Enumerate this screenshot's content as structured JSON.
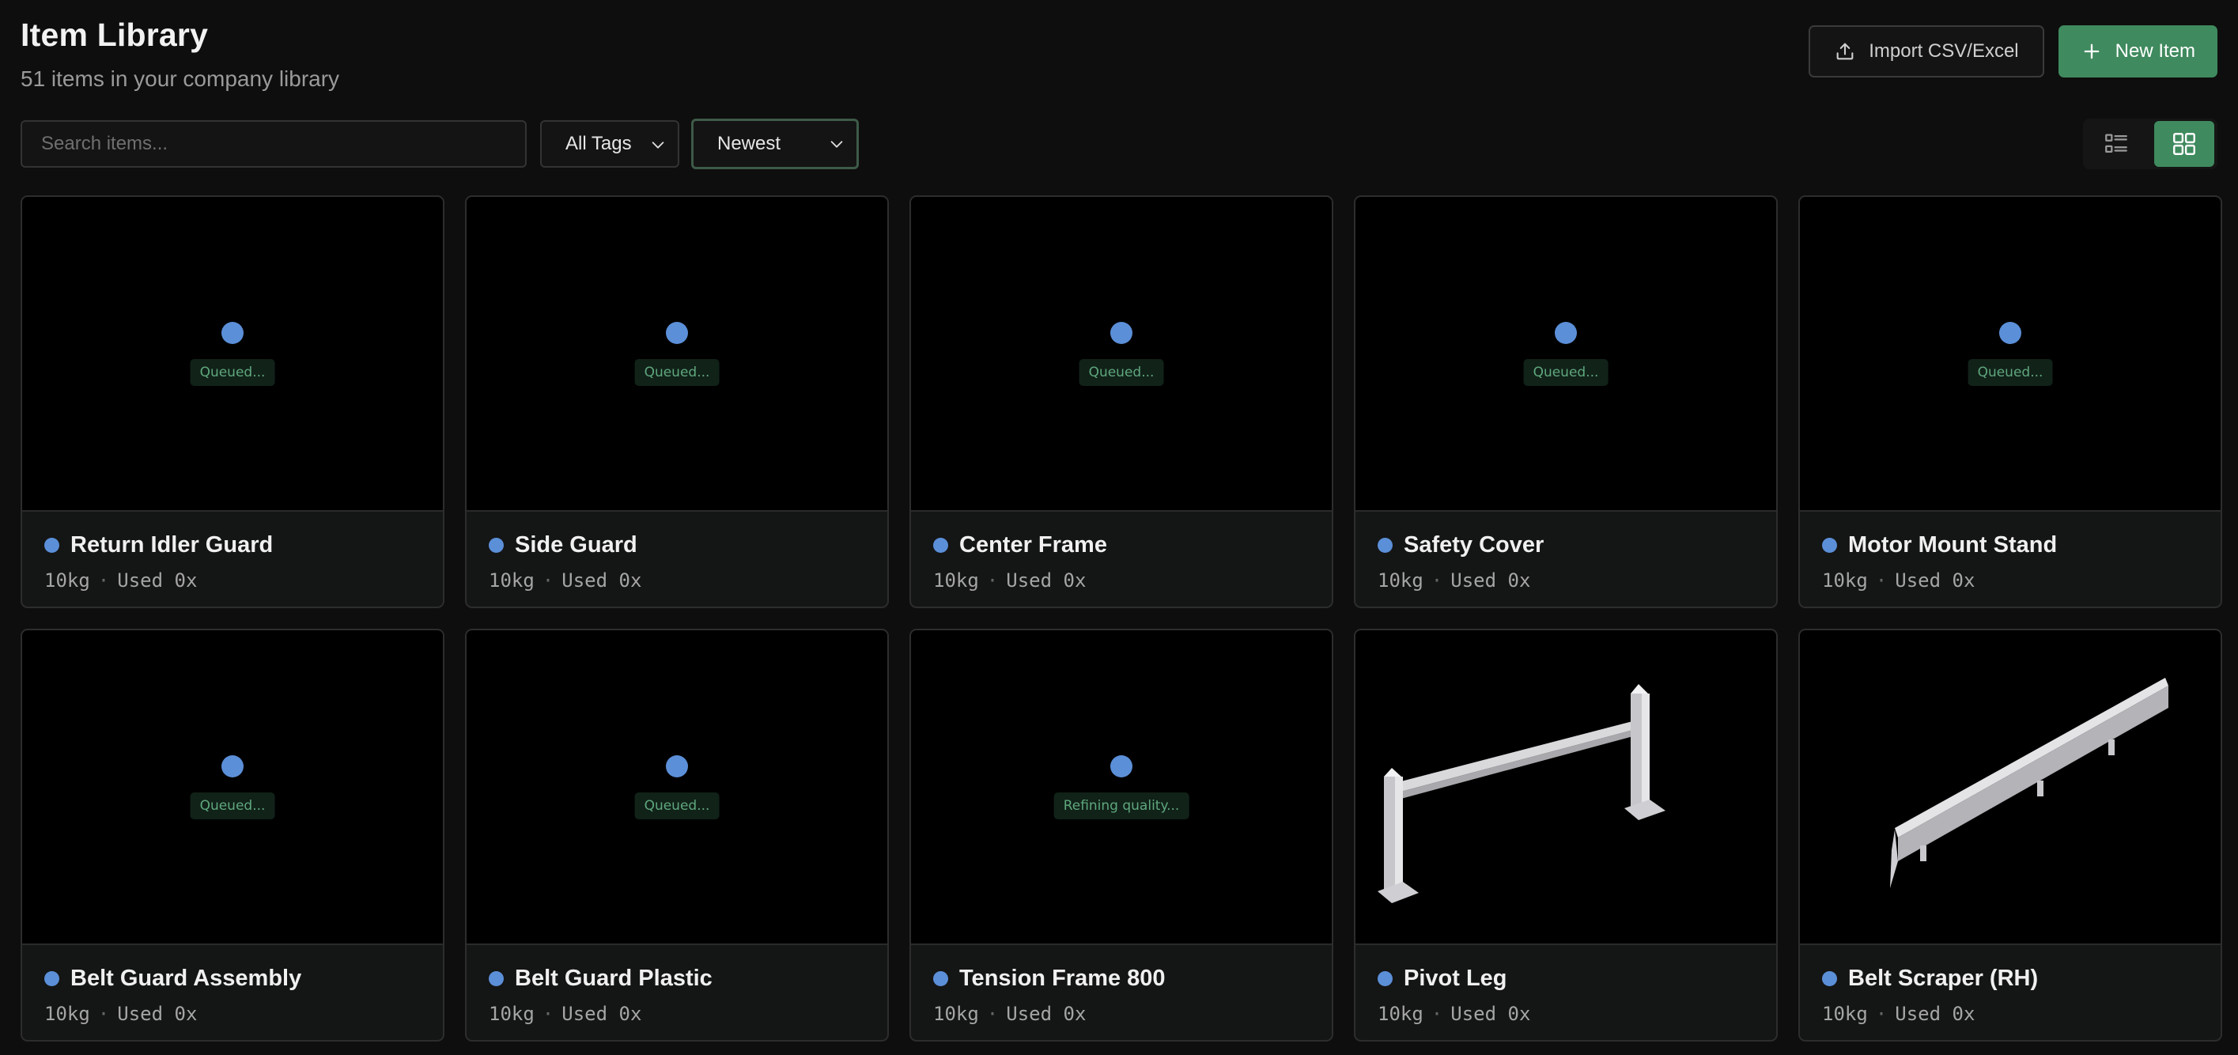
{
  "header": {
    "title": "Item Library",
    "subtitle": "51 items in your company library",
    "import_label": "Import CSV/Excel",
    "new_label": "New Item"
  },
  "toolbar": {
    "search_placeholder": "Search items...",
    "tags_value": "All Tags",
    "sort_value": "Newest",
    "view_mode": "grid"
  },
  "colors": {
    "accent_green": "#3f8a5e",
    "status_dot_blue": "#5b8fd8",
    "status_text_green": "#5fa77d"
  },
  "items": [
    {
      "name": "Return Idler Guard",
      "weight": "10kg",
      "used": "Used 0x",
      "status": "Queued..."
    },
    {
      "name": "Side Guard",
      "weight": "10kg",
      "used": "Used 0x",
      "status": "Queued..."
    },
    {
      "name": "Center Frame",
      "weight": "10kg",
      "used": "Used 0x",
      "status": "Queued..."
    },
    {
      "name": "Safety Cover",
      "weight": "10kg",
      "used": "Used 0x",
      "status": "Queued..."
    },
    {
      "name": "Motor Mount Stand",
      "weight": "10kg",
      "used": "Used 0x",
      "status": "Queued..."
    },
    {
      "name": "Belt Guard Assembly",
      "weight": "10kg",
      "used": "Used 0x",
      "status": "Queued..."
    },
    {
      "name": "Belt Guard Plastic",
      "weight": "10kg",
      "used": "Used 0x",
      "status": "Queued..."
    },
    {
      "name": "Tension Frame 800",
      "weight": "10kg",
      "used": "Used 0x",
      "status": "Refining quality..."
    },
    {
      "name": "Pivot Leg",
      "weight": "10kg",
      "used": "Used 0x",
      "status": ""
    },
    {
      "name": "Belt Scraper (RH)",
      "weight": "10kg",
      "used": "Used 0x",
      "status": ""
    }
  ]
}
